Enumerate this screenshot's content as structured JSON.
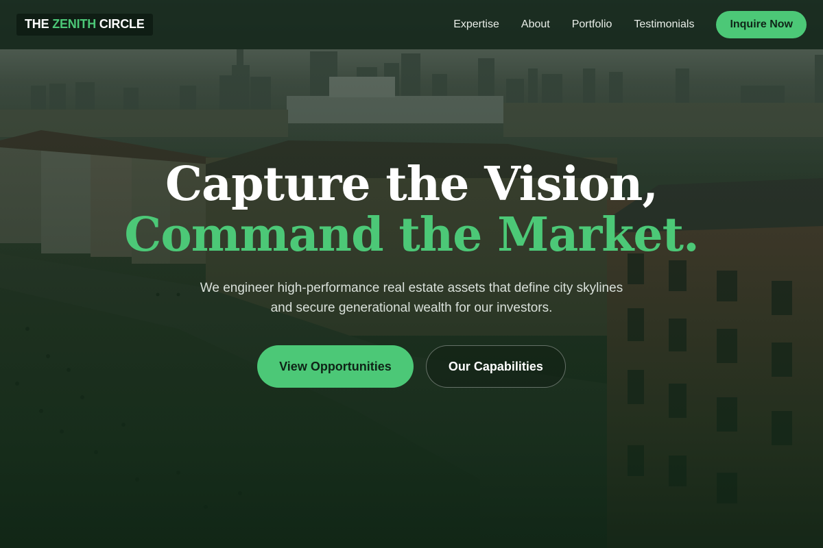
{
  "nav": {
    "logo_main": "THE ",
    "logo_accent": "ZENITH",
    "logo_tail": " CIRCLE",
    "links": [
      "Expertise",
      "About",
      "Portfolio",
      "Testimonials"
    ],
    "cta_label": "Inquire Now"
  },
  "hero": {
    "headline_line1": "Capture the Vision,",
    "headline_line2": "Command the Market.",
    "subtitle": "We engineer high-performance real estate assets that define city skylines and secure generational wealth for our investors.",
    "primary_cta": "View Opportunities",
    "secondary_cta": "Our Capabilities"
  },
  "colors": {
    "accent": "#4cc877",
    "nav_bg": "#16281c",
    "logo_bg": "#0f1d14",
    "headline_white": "#ffffff"
  }
}
